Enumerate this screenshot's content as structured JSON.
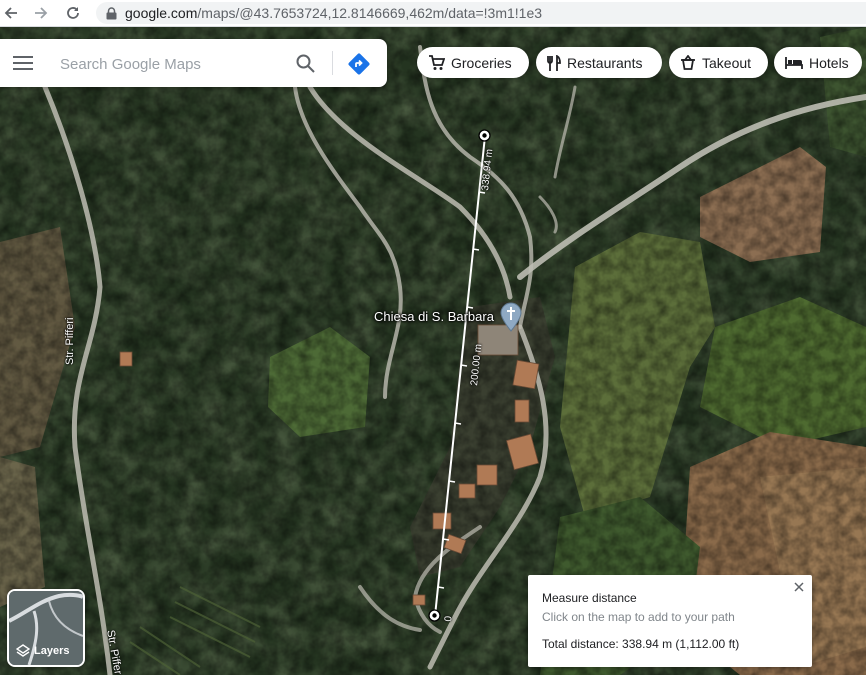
{
  "browser": {
    "url_host": "google.com",
    "url_path": "/maps/@43.7653724,12.8146669,462m/data=!3m1!1e3"
  },
  "search": {
    "placeholder": "Search Google Maps"
  },
  "chips": [
    {
      "label": "Groceries",
      "icon": "cart-icon"
    },
    {
      "label": "Restaurants",
      "icon": "fork-knife-icon"
    },
    {
      "label": "Takeout",
      "icon": "takeout-icon"
    },
    {
      "label": "Hotels",
      "icon": "bed-icon"
    }
  ],
  "map": {
    "poi_label": "Chiesa di S. Barbara",
    "road_labels": [
      "Str. Pifferi",
      "Str. Piffer"
    ],
    "measure_labels": {
      "top": "338.94 m",
      "middle": "200.00 m",
      "start": "0"
    }
  },
  "layers": {
    "label": "Layers"
  },
  "measure_card": {
    "title": "Measure distance",
    "hint": "Click on the map to add to your path",
    "total": "Total distance: 338.94 m (1,112.00 ft)"
  },
  "colors": {
    "accent": "#1a73e8",
    "forest_dark": "#1e2c18",
    "field_brown": "#8a6a4a",
    "road": "#c8c8c0"
  }
}
